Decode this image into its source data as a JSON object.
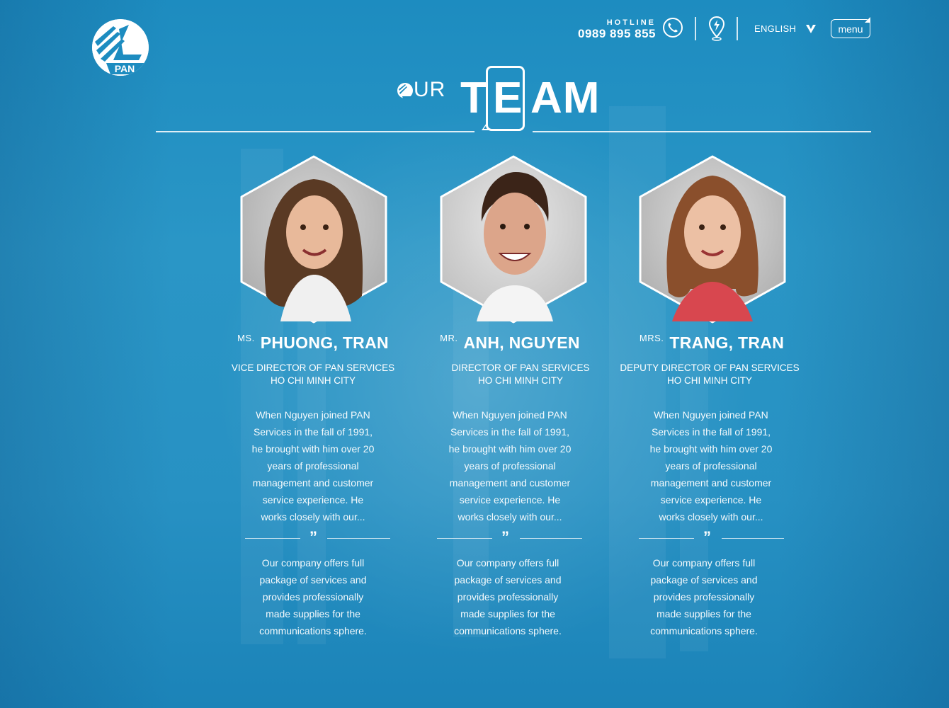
{
  "header": {
    "logo_text": "PAN",
    "hotline_label": "HOTLINE",
    "hotline_number": "0989 895 855",
    "language": "ENGLISH",
    "menu_label": "menu"
  },
  "title": {
    "our": "UR",
    "team_t": "T",
    "team_e": "E",
    "team_am": "AM"
  },
  "team": [
    {
      "prefix": "MS.",
      "name": "PHUONG, TRAN",
      "role_line1": "VICE DIRECTOR OF PAN SERVICES",
      "role_line2": "HO CHI MINH CITY",
      "bio": "When Nguyen joined PAN Services in the fall of 1991, he brought with him over 20 years of professional management and customer service experience. He works closely with our...",
      "quote_mark": "”",
      "quote": "Our company offers full package of services and provides professionally made supplies for the communications sphere."
    },
    {
      "prefix": "MR.",
      "name": "ANH, NGUYEN",
      "role_line1": "DIRECTOR OF PAN SERVICES",
      "role_line2": "HO CHI MINH CITY",
      "bio": "When Nguyen joined PAN Services in the fall of 1991, he brought with him over 20 years of professional management and customer service experience. He works closely with our...",
      "quote_mark": "”",
      "quote": "Our company offers full package of services and provides professionally made supplies for the communications sphere."
    },
    {
      "prefix": "MRS.",
      "name": "TRANG, TRAN",
      "role_line1": "DEPUTY DIRECTOR OF PAN SERVICES",
      "role_line2": "HO CHI MINH CITY",
      "bio": "When Nguyen joined PAN Services in the fall of 1991, he brought with him over 20 years of professional management and customer service experience. He works closely with our...",
      "quote_mark": "”",
      "quote": "Our company offers full package of services and provides professionally made supplies for the communications sphere."
    }
  ],
  "colors": {
    "background": "#2a96c6",
    "accent": "#1a84bb",
    "text": "#ffffff"
  }
}
